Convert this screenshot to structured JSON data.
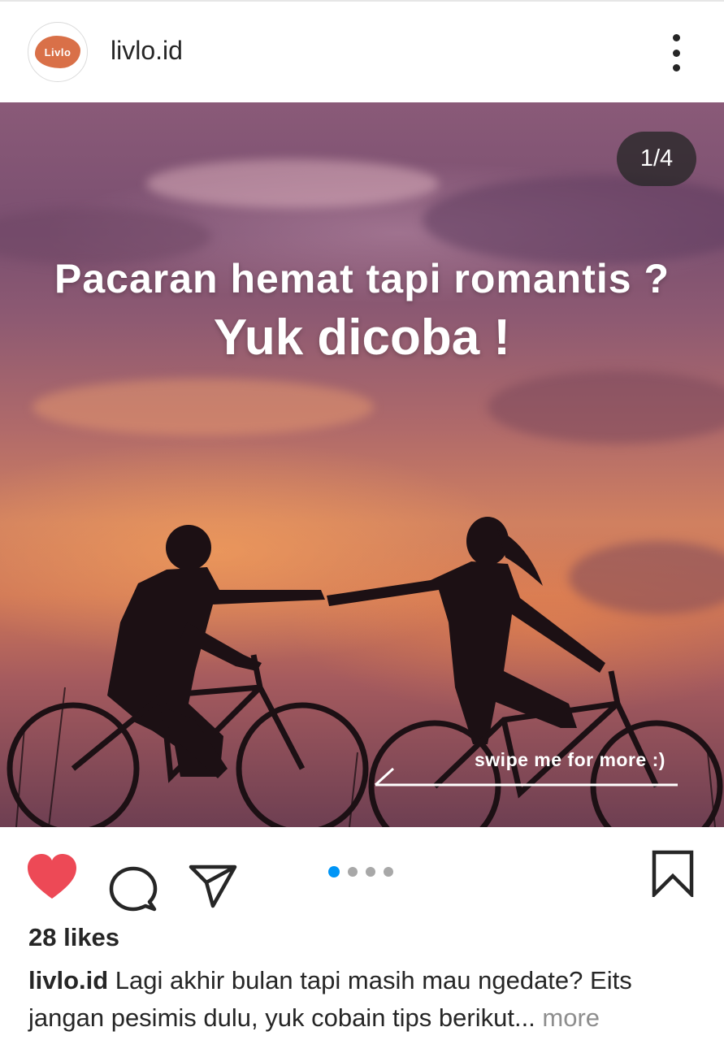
{
  "header": {
    "avatar_text": "Livlo",
    "username": "livlo.id",
    "more_icon": "more-vertical-icon"
  },
  "post": {
    "counter": "1/4",
    "headline_line1": "Pacaran hemat tapi romantis ?",
    "headline_line2": "Yuk dicoba !",
    "swipe_label": "swipe me for more :)",
    "carousel": {
      "total": 4,
      "active_index": 0
    }
  },
  "actions": {
    "like_icon": "heart-filled-icon",
    "comment_icon": "comment-icon",
    "share_icon": "paper-plane-icon",
    "save_icon": "bookmark-icon",
    "like_color": "#ed4956",
    "active_dot_color": "#0095f6"
  },
  "likes": "28 likes",
  "caption": {
    "username": "livlo.id",
    "text": " Lagi akhir bulan tapi masih mau ngedate? Eits jangan pesimis dulu, yuk cobain tips berikut",
    "ellipsis": "...",
    "more": " more"
  }
}
